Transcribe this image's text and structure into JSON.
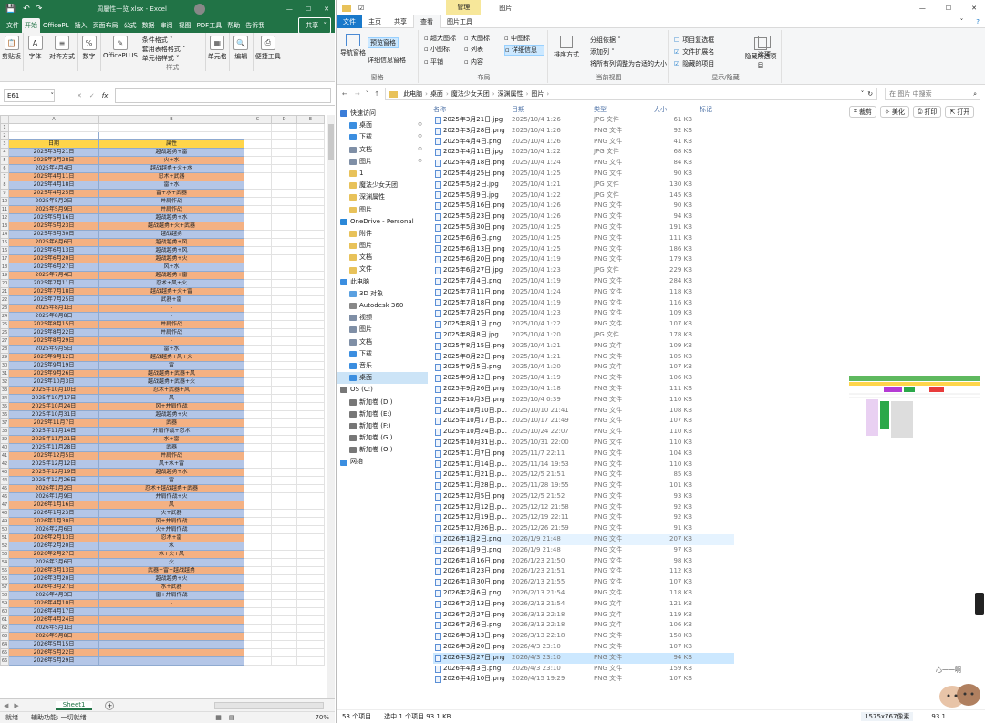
{
  "excel": {
    "qa_menu": "文件",
    "title": "周屬性一览.xlsx - Excel",
    "share": "共享",
    "tabs": [
      "开始",
      "OfficePL",
      "插入",
      "页面布局",
      "公式",
      "数据",
      "审阅",
      "视图",
      "PDF工具",
      "帮助",
      "告诉我"
    ],
    "active_tab": "开始",
    "ribbon": {
      "groups": [
        {
          "label": "剪贴板",
          "icon": "clipboard-icon",
          "glyph": "📋"
        },
        {
          "label": "字体",
          "icon": "font-icon",
          "glyph": "A"
        },
        {
          "label": "对齐方式",
          "icon": "align-icon",
          "glyph": "≡"
        },
        {
          "label": "数字",
          "icon": "percent-icon",
          "glyph": "%"
        },
        {
          "label": "OfficePLUS",
          "icon": "officeplus-icon",
          "glyph": "✎"
        }
      ],
      "styles_items": [
        "条件格式 ˅",
        "套用表格格式 ˅",
        "单元格样式 ˅"
      ],
      "styles_label": "样式",
      "cells_label": "单元格",
      "edit_label": "编辑",
      "print_label": "便捷工具"
    },
    "name_box": "E61",
    "fx": "fx",
    "columns": [
      "A",
      "B",
      "C",
      "D",
      "E"
    ],
    "header_row": [
      "日期",
      "属性"
    ],
    "rows": [
      [
        "2025年3月21日",
        "越战越勇+雷",
        "b"
      ],
      [
        "2025年3月28日",
        "火+水",
        "o"
      ],
      [
        "2025年4月4日",
        "越战越勇+火+水",
        "b"
      ],
      [
        "2025年4月11日",
        "忍术+武器",
        "o"
      ],
      [
        "2025年4月18日",
        "雷+水",
        "b"
      ],
      [
        "2025年4月25日",
        "雷+水+武器",
        "o"
      ],
      [
        "2025年5月2日",
        "并肩作战",
        "b"
      ],
      [
        "2025年5月9日",
        "并肩作战",
        "o"
      ],
      [
        "2025年5月16日",
        "越战越勇+水",
        "b"
      ],
      [
        "2025年5月23日",
        "越战越勇+火+武器",
        "o"
      ],
      [
        "2025年5月30日",
        "越战越勇",
        "b"
      ],
      [
        "2025年6月6日",
        "越战越勇+风",
        "o"
      ],
      [
        "2025年6月13日",
        "越战越勇+风",
        "b"
      ],
      [
        "2025年6月20日",
        "越战越勇+火",
        "o"
      ],
      [
        "2025年6月27日",
        "风+水",
        "b"
      ],
      [
        "2025年7月4日",
        "越战越勇+雷",
        "o"
      ],
      [
        "2025年7月11日",
        "忍术+风+火",
        "b"
      ],
      [
        "2025年7月18日",
        "越战越勇+火+雷",
        "o"
      ],
      [
        "2025年7月25日",
        "武器+雷",
        "b"
      ],
      [
        "2025年8月1日",
        "-",
        "o"
      ],
      [
        "2025年8月8日",
        "-",
        "b"
      ],
      [
        "2025年8月15日",
        "并肩作战",
        "o"
      ],
      [
        "2025年8月22日",
        "并肩作战",
        "b"
      ],
      [
        "2025年8月29日",
        "-",
        "o"
      ],
      [
        "2025年9月5日",
        "雷+水",
        "b"
      ],
      [
        "2025年9月12日",
        "越战越勇+风+火",
        "o"
      ],
      [
        "2025年9月19日",
        "雷",
        "b"
      ],
      [
        "2025年9月26日",
        "越战越勇+武器+风",
        "o"
      ],
      [
        "2025年10月3日",
        "越战越勇+武器+火",
        "b"
      ],
      [
        "2025年10月10日",
        "忍术+武器+风",
        "o"
      ],
      [
        "2025年10月17日",
        "风",
        "b"
      ],
      [
        "2025年10月24日",
        "风+并肩作战",
        "o"
      ],
      [
        "2025年10月31日",
        "越战越勇+火",
        "b"
      ],
      [
        "2025年11月7日",
        "武器",
        "o"
      ],
      [
        "2025年11月14日",
        "并肩作战+忍术",
        "b"
      ],
      [
        "2025年11月21日",
        "水+雷",
        "o"
      ],
      [
        "2025年11月28日",
        "武器",
        "b"
      ],
      [
        "2025年12月5日",
        "并肩作战",
        "o"
      ],
      [
        "2025年12月12日",
        "风+水+雷",
        "b"
      ],
      [
        "2025年12月19日",
        "越战越勇+水",
        "o"
      ],
      [
        "2025年12月26日",
        "雷",
        "b"
      ],
      [
        "2026年1月2日",
        "忍术+越战越勇+武器",
        "o"
      ],
      [
        "2026年1月9日",
        "并肩作战+火",
        "b"
      ],
      [
        "2026年1月16日",
        "风",
        "o"
      ],
      [
        "2026年1月23日",
        "火+武器",
        "b"
      ],
      [
        "2026年1月30日",
        "风+并肩作战",
        "o"
      ],
      [
        "2026年2月6日",
        "火+并肩作战",
        "b"
      ],
      [
        "2026年2月13日",
        "忍术+雷",
        "o"
      ],
      [
        "2026年2月20日",
        "水",
        "b"
      ],
      [
        "2026年2月27日",
        "水+火+风",
        "o"
      ],
      [
        "2026年3月6日",
        "火",
        "b"
      ],
      [
        "2026年3月13日",
        "武器+雷+越战越勇",
        "o"
      ],
      [
        "2026年3月20日",
        "越战越勇+火",
        "b"
      ],
      [
        "2026年3月27日",
        "水+武器",
        "o"
      ],
      [
        "2026年4月3日",
        "雷+并肩作战",
        "b"
      ],
      [
        "2026年4月10日",
        "-",
        "o"
      ],
      [
        "2026年4月17日",
        "",
        "b"
      ],
      [
        "2026年4月24日",
        "",
        "o"
      ],
      [
        "2026年5月1日",
        "",
        "b"
      ],
      [
        "2026年5月8日",
        "",
        "o"
      ],
      [
        "2026年5月15日",
        "",
        "b"
      ],
      [
        "2026年5月22日",
        "",
        "o"
      ],
      [
        "2026年5月29日",
        "",
        "b"
      ]
    ],
    "sheet_tab": "Sheet1",
    "add_sheet": "+",
    "status": {
      "ready": "就绪",
      "accessibility": "辅助功能: 一切就绪",
      "zoom": "70%"
    }
  },
  "explorer": {
    "title": "图片",
    "manage": "管理",
    "tabs": [
      "文件",
      "主页",
      "共享",
      "查看",
      "图片工具"
    ],
    "ribbon": {
      "nav_pane": "导航窗格",
      "preview_pane": "预览窗格",
      "details_pane": "详细信息窗格",
      "pane_label": "窗格",
      "layouts": [
        "超大图标",
        "大图标",
        "中图标",
        "小图标",
        "列表",
        "详细信息",
        "平铺",
        "内容"
      ],
      "layout_label": "布局",
      "sort": "排序方式",
      "group": "分组依据 ˅",
      "add_col": "添加列 ˅",
      "fit_cols": "将所有列调整为合适的大小",
      "view_label": "当前视图",
      "checks": [
        {
          "label": "项目复选框",
          "checked": false
        },
        {
          "label": "文件扩展名",
          "checked": true
        },
        {
          "label": "隐藏的项目",
          "checked": true
        }
      ],
      "hide_sel": "隐藏所选项目",
      "options": "选项",
      "show_label": "显示/隐藏"
    },
    "breadcrumb": [
      "此电脑",
      "桌面",
      "魔法少女天团",
      "深渊属性",
      "图片"
    ],
    "search_placeholder": "在 图片 中搜索",
    "nav": [
      {
        "label": "快速访问",
        "color": "#3b7dd8"
      },
      {
        "label": "桌面",
        "color": "#3b8ee0"
      },
      {
        "label": "下载",
        "color": "#3b8ee0"
      },
      {
        "label": "文档",
        "color": "#7f8fa6"
      },
      {
        "label": "图片",
        "color": "#7f8fa6"
      },
      {
        "label": "1",
        "color": "#e8c25a"
      },
      {
        "label": "魔法少女天团",
        "color": "#e8c25a"
      },
      {
        "label": "深渊属性",
        "color": "#e8c25a"
      },
      {
        "label": "图片",
        "color": "#e8c25a"
      },
      {
        "label": "OneDrive - Personal",
        "color": "#2b88d8"
      },
      {
        "label": "附件",
        "color": "#e8c25a"
      },
      {
        "label": "图片",
        "color": "#e8c25a"
      },
      {
        "label": "文档",
        "color": "#e8c25a"
      },
      {
        "label": "文件",
        "color": "#e8c25a"
      },
      {
        "label": "此电脑",
        "color": "#3b8ee0"
      },
      {
        "label": "3D 对象",
        "color": "#5aa0e0"
      },
      {
        "label": "Autodesk 360",
        "color": "#888888"
      },
      {
        "label": "视频",
        "color": "#7f8fa6"
      },
      {
        "label": "图片",
        "color": "#7f8fa6"
      },
      {
        "label": "文档",
        "color": "#7f8fa6"
      },
      {
        "label": "下载",
        "color": "#3b8ee0"
      },
      {
        "label": "音乐",
        "color": "#3b8ee0"
      },
      {
        "label": "桌面",
        "color": "#3b8ee0"
      },
      {
        "label": "OS (C:)",
        "color": "#777777"
      },
      {
        "label": "新加卷 (D:)",
        "color": "#777777"
      },
      {
        "label": "新加卷 (E:)",
        "color": "#777777"
      },
      {
        "label": "新加卷 (F:)",
        "color": "#777777"
      },
      {
        "label": "新加卷 (G:)",
        "color": "#777777"
      },
      {
        "label": "新加卷 (O:)",
        "color": "#777777"
      },
      {
        "label": "网络",
        "color": "#3b8ee0"
      }
    ],
    "columns": [
      "名称",
      "日期",
      "类型",
      "大小",
      "标记"
    ],
    "files": [
      [
        "2025年3月21日.jpg",
        "2025/10/4 1:26",
        "JPG 文件",
        "61 KB"
      ],
      [
        "2025年3月28日.png",
        "2025/10/4 1:26",
        "PNG 文件",
        "92 KB"
      ],
      [
        "2025年4月4日.png",
        "2025/10/4 1:26",
        "PNG 文件",
        "41 KB"
      ],
      [
        "2025年4月11日.jpg",
        "2025/10/4 1:22",
        "JPG 文件",
        "68 KB"
      ],
      [
        "2025年4月18日.png",
        "2025/10/4 1:24",
        "PNG 文件",
        "84 KB"
      ],
      [
        "2025年4月25日.png",
        "2025/10/4 1:25",
        "PNG 文件",
        "90 KB"
      ],
      [
        "2025年5月2日.jpg",
        "2025/10/4 1:21",
        "JPG 文件",
        "130 KB"
      ],
      [
        "2025年5月9日.jpg",
        "2025/10/4 1:22",
        "JPG 文件",
        "145 KB"
      ],
      [
        "2025年5月16日.png",
        "2025/10/4 1:26",
        "PNG 文件",
        "90 KB"
      ],
      [
        "2025年5月23日.png",
        "2025/10/4 1:26",
        "PNG 文件",
        "94 KB"
      ],
      [
        "2025年5月30日.png",
        "2025/10/4 1:25",
        "PNG 文件",
        "191 KB"
      ],
      [
        "2025年6月6日.png",
        "2025/10/4 1:25",
        "PNG 文件",
        "111 KB"
      ],
      [
        "2025年6月13日.png",
        "2025/10/4 1:25",
        "PNG 文件",
        "186 KB"
      ],
      [
        "2025年6月20日.png",
        "2025/10/4 1:19",
        "PNG 文件",
        "179 KB"
      ],
      [
        "2025年6月27日.jpg",
        "2025/10/4 1:23",
        "JPG 文件",
        "229 KB"
      ],
      [
        "2025年7月4日.png",
        "2025/10/4 1:19",
        "PNG 文件",
        "284 KB"
      ],
      [
        "2025年7月11日.png",
        "2025/10/4 1:24",
        "PNG 文件",
        "118 KB"
      ],
      [
        "2025年7月18日.png",
        "2025/10/4 1:19",
        "PNG 文件",
        "116 KB"
      ],
      [
        "2025年7月25日.png",
        "2025/10/4 1:23",
        "PNG 文件",
        "109 KB"
      ],
      [
        "2025年8月1日.png",
        "2025/10/4 1:22",
        "PNG 文件",
        "107 KB"
      ],
      [
        "2025年8月8日.jpg",
        "2025/10/4 1:20",
        "JPG 文件",
        "178 KB"
      ],
      [
        "2025年8月15日.png",
        "2025/10/4 1:21",
        "PNG 文件",
        "109 KB"
      ],
      [
        "2025年8月22日.png",
        "2025/10/4 1:21",
        "PNG 文件",
        "105 KB"
      ],
      [
        "2025年9月5日.png",
        "2025/10/4 1:20",
        "PNG 文件",
        "107 KB"
      ],
      [
        "2025年9月12日.png",
        "2025/10/4 1:19",
        "PNG 文件",
        "106 KB"
      ],
      [
        "2025年9月26日.png",
        "2025/10/4 1:18",
        "PNG 文件",
        "111 KB"
      ],
      [
        "2025年10月3日.png",
        "2025/10/4 0:39",
        "PNG 文件",
        "110 KB"
      ],
      [
        "2025年10月10日.p...",
        "2025/10/10 21:41",
        "PNG 文件",
        "108 KB"
      ],
      [
        "2025年10月17日.p...",
        "2025/10/17 21:49",
        "PNG 文件",
        "107 KB"
      ],
      [
        "2025年10月24日.p...",
        "2025/10/24 22:07",
        "PNG 文件",
        "110 KB"
      ],
      [
        "2025年10月31日.p...",
        "2025/10/31 22:00",
        "PNG 文件",
        "110 KB"
      ],
      [
        "2025年11月7日.png",
        "2025/11/7 22:11",
        "PNG 文件",
        "104 KB"
      ],
      [
        "2025年11月14日.p...",
        "2025/11/14 19:53",
        "PNG 文件",
        "110 KB"
      ],
      [
        "2025年11月21日.p...",
        "2025/12/5 21:51",
        "PNG 文件",
        "85 KB"
      ],
      [
        "2025年11月28日.p...",
        "2025/11/28 19:55",
        "PNG 文件",
        "101 KB"
      ],
      [
        "2025年12月5日.png",
        "2025/12/5 21:52",
        "PNG 文件",
        "93 KB"
      ],
      [
        "2025年12月12日.p...",
        "2025/12/12 21:58",
        "PNG 文件",
        "92 KB"
      ],
      [
        "2025年12月19日.p...",
        "2025/12/19 22:11",
        "PNG 文件",
        "92 KB"
      ],
      [
        "2025年12月26日.p...",
        "2025/12/26 21:59",
        "PNG 文件",
        "91 KB"
      ],
      [
        "2026年1月2日.png",
        "2026/1/9 21:48",
        "PNG 文件",
        "207 KB"
      ],
      [
        "2026年1月9日.png",
        "2026/1/9 21:48",
        "PNG 文件",
        "97 KB"
      ],
      [
        "2026年1月16日.png",
        "2026/1/23 21:50",
        "PNG 文件",
        "98 KB"
      ],
      [
        "2026年1月23日.png",
        "2026/1/23 21:51",
        "PNG 文件",
        "112 KB"
      ],
      [
        "2026年1月30日.png",
        "2026/2/13 21:55",
        "PNG 文件",
        "107 KB"
      ],
      [
        "2026年2月6日.png",
        "2026/2/13 21:54",
        "PNG 文件",
        "118 KB"
      ],
      [
        "2026年2月13日.png",
        "2026/2/13 21:54",
        "PNG 文件",
        "121 KB"
      ],
      [
        "2026年2月27日.png",
        "2026/3/13 22:18",
        "PNG 文件",
        "119 KB"
      ],
      [
        "2026年3月6日.png",
        "2026/3/13 22:18",
        "PNG 文件",
        "106 KB"
      ],
      [
        "2026年3月13日.png",
        "2026/3/13 22:18",
        "PNG 文件",
        "158 KB"
      ],
      [
        "2026年3月20日.png",
        "2026/4/3 23:10",
        "PNG 文件",
        "107 KB"
      ],
      [
        "2026年3月27日.png",
        "2026/4/3 23:10",
        "PNG 文件",
        "94 KB"
      ],
      [
        "2026年4月3日.png",
        "2026/4/3 23:10",
        "PNG 文件",
        "159 KB"
      ],
      [
        "2026年4月10日.png",
        "2026/4/15 19:29",
        "PNG 文件",
        "107 KB"
      ]
    ],
    "hover_index": 39,
    "selected_index": 50,
    "preview_actions": [
      "裁剪",
      "美化",
      "打印",
      "打开"
    ],
    "status": {
      "count": "53 个项目",
      "selected": "选中 1 个项目 93.1 KB",
      "dims": "1575x767像素",
      "zoom": "93.1"
    },
    "sticker_text": "心一一啊"
  }
}
